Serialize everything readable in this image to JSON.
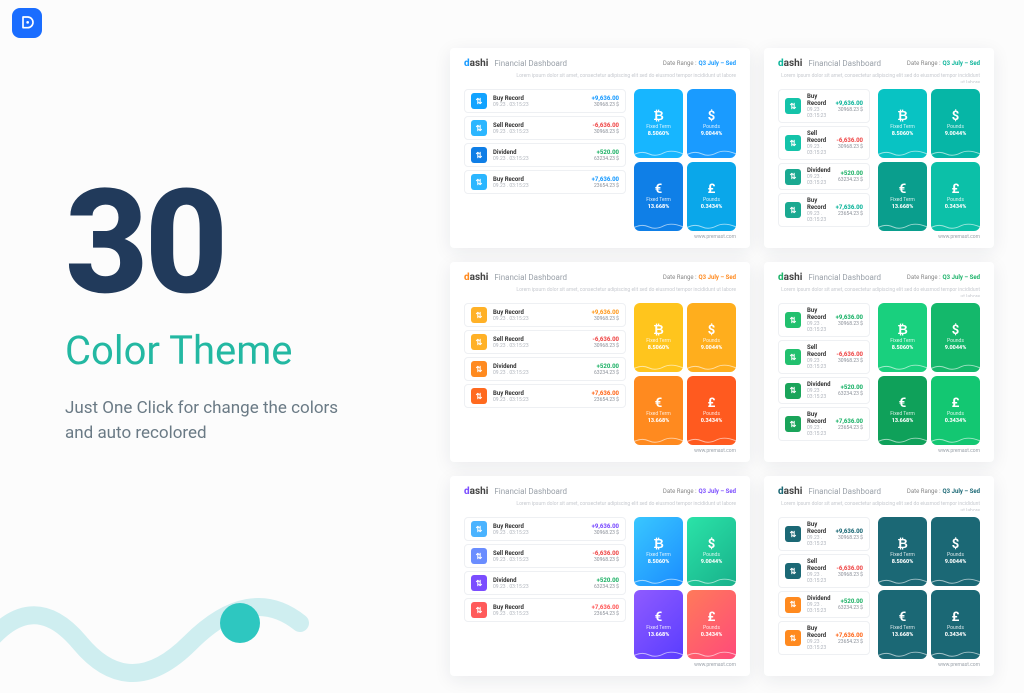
{
  "hero": {
    "number": "30",
    "title": "Color Theme",
    "subtitle": "Just One Click for change the colors and auto recolored"
  },
  "dashboard": {
    "logo": "dashi",
    "header_sub": "Financial Dashboard",
    "date_label": "Date Range :",
    "date_range": "Q3 July – Sed",
    "lorem": "Lorem ipsum dolor sit amet, consectetur adipiscing elit sed do eiusmod tempor incididunt ut labore",
    "footer": "www.premast.com",
    "rows": [
      {
        "title": "Buy Record",
        "date": "09.23 . 03:15:23",
        "amount": "+9,636.00",
        "sub": "30968.23 $",
        "sign": "pos"
      },
      {
        "title": "Sell Record",
        "date": "09.23 . 03:15:23",
        "amount": "-6,636.00",
        "sub": "30968.23 $",
        "sign": "neg"
      },
      {
        "title": "Dividend",
        "date": "09.23 . 03:15:23",
        "amount": "+520.00",
        "sub": "63234.23 $",
        "sign": "pos"
      },
      {
        "title": "Buy Record",
        "date": "09.23 . 03:15:23",
        "amount": "+7,636.00",
        "sub": "23654.23 $",
        "sign": "pos"
      }
    ],
    "tiles": [
      {
        "sym": "₿",
        "label": "Fixed Term",
        "pct": "8.5060%"
      },
      {
        "sym": "$",
        "label": "Pounds",
        "pct": "9.0044%"
      },
      {
        "sym": "€",
        "label": "Fixed Term",
        "pct": "13.668%"
      },
      {
        "sym": "£",
        "label": "Pounds",
        "pct": "0.3434%"
      }
    ]
  },
  "themes": [
    {
      "cls": "t-blue",
      "cut": false,
      "row_icons": [
        "#12a3ff",
        "#2bb6ff",
        "#0f7ee6",
        "#2bb6ff"
      ],
      "amt_colors": [
        "#1a9bff",
        "#ef4a4a",
        "#23b36a",
        "#1a9bff"
      ],
      "tile_bg": [
        "#17b6ff",
        "#1a9bff",
        "#0f7fe7",
        "#0aa7ea"
      ]
    },
    {
      "cls": "t-teal",
      "cut": true,
      "row_icons": [
        "#14c3a9",
        "#14c3a9",
        "#1aa991",
        "#1aa991"
      ],
      "amt_colors": [
        "#0fb59b",
        "#ef4a4a",
        "#23b36a",
        "#0fb59b"
      ],
      "tile_bg": [
        "#08c3c3",
        "#06b6a6",
        "#0a9e8d",
        "#0cc0a8"
      ]
    },
    {
      "cls": "t-orange",
      "cut": false,
      "row_icons": [
        "#ffb127",
        "#ffb127",
        "#ff8a1f",
        "#ff6a1f"
      ],
      "amt_colors": [
        "#ff9a1f",
        "#ef4a4a",
        "#23b36a",
        "#ff6a1f"
      ],
      "tile_bg": [
        "#ffc51d",
        "#ffae1d",
        "#ff8a1f",
        "#ff5a1f"
      ]
    },
    {
      "cls": "t-green",
      "cut": true,
      "row_icons": [
        "#22c06e",
        "#22c06e",
        "#1aa45a",
        "#1aa45a"
      ],
      "amt_colors": [
        "#1db36a",
        "#ef4a4a",
        "#1db36a",
        "#1db36a"
      ],
      "tile_bg": [
        "#19d07e",
        "#14b86b",
        "#0fa15a",
        "#13c772"
      ]
    },
    {
      "cls": "t-purple",
      "cut": false,
      "row_icons": [
        "#4ab3ff",
        "#6a8dff",
        "#7b4dff",
        "#ff5a5a"
      ],
      "amt_colors": [
        "#7b4dff",
        "#ef4a4a",
        "#23b36a",
        "#ff5a5a"
      ],
      "tile_bg": [
        "linear-gradient(135deg,#39c7ff,#1b8dff)",
        "linear-gradient(135deg,#2be3a8,#18b18b)",
        "linear-gradient(135deg,#8f5bff,#5a3dff)",
        "linear-gradient(135deg,#ff7a5a,#ff4a7a)"
      ]
    },
    {
      "cls": "t-dark",
      "cut": true,
      "row_icons": [
        "#1b6875",
        "#1b6875",
        "#ff8a1f",
        "#ff8a1f"
      ],
      "amt_colors": [
        "#1b6875",
        "#ef4a4a",
        "#23b36a",
        "#ff6a1f"
      ],
      "tile_bg": [
        "#1b6875",
        "#1b6875",
        "#1b6875",
        "#1b6875"
      ]
    }
  ]
}
